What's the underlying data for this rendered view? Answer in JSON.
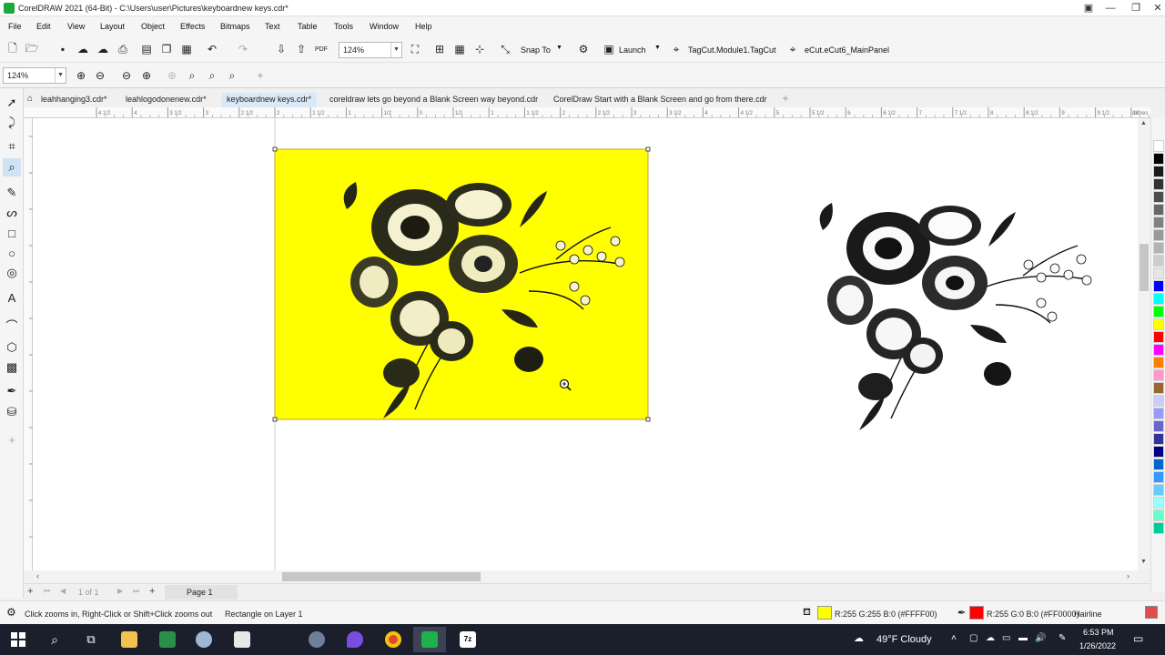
{
  "window": {
    "title": "CorelDRAW 2021 (64-Bit) - C:\\Users\\user\\Pictures\\keyboardnew keys.cdr*",
    "minimize": "—",
    "maximize": "❐",
    "close": "✕"
  },
  "menu": [
    "File",
    "Edit",
    "View",
    "Layout",
    "Object",
    "Effects",
    "Bitmaps",
    "Text",
    "Table",
    "Tools",
    "Window",
    "Help"
  ],
  "toolbar1": {
    "zoom_value": "124%",
    "snap_to": "Snap To",
    "launch": "Launch",
    "macro1": "TagCut.Module1.TagCut",
    "macro2": "eCut.eCut6_MainPanel"
  },
  "toolbar2": {
    "zoom_value": "124%"
  },
  "tabs": [
    {
      "label": "leahhanging3.cdr*",
      "active": false
    },
    {
      "label": "leahlogodonenew.cdr*",
      "active": false
    },
    {
      "label": "keyboardnew keys.cdr*",
      "active": true
    },
    {
      "label": "coreldraw lets go beyond a Blank Screen way beyond.cdr",
      "active": false
    },
    {
      "label": "CorelDraw Start with a Blank Screen and go from there.cdr",
      "active": false
    }
  ],
  "ruler": {
    "unit": "inches",
    "labels": [
      "4 1/2",
      "4",
      "3 1/2",
      "3",
      "2 1/2",
      "2",
      "1 1/2",
      "1",
      "1/2",
      "0",
      "1/2",
      "1",
      "1 1/2",
      "2",
      "2 1/2",
      "3",
      "3 1/2",
      "4",
      "4 1/2",
      "5",
      "5 1/2",
      "6",
      "6 1/2",
      "7",
      "7 1/2",
      "8",
      "8 1/2",
      "9",
      "9 1/2",
      "10",
      "10 1/2",
      "11",
      "11 1/2"
    ]
  },
  "pager": {
    "page_count": "1 of 1",
    "page_tab": "Page 1"
  },
  "status": {
    "hint": "Click zooms in, Right-Click or Shift+Click zooms out",
    "selection": "Rectangle on Layer 1",
    "fill_label": "R:255 G:255 B:0 (#FFFF00)",
    "fill_color": "#FFFF00",
    "outline_label": "R:255 G:0 B:0 (#FF0000)",
    "outline_color": "#FF0000",
    "outline_width": "Hairline"
  },
  "palette": [
    "#ffffff",
    "#000000",
    "#1a1a1a",
    "#333333",
    "#4d4d4d",
    "#666666",
    "#808080",
    "#999999",
    "#b3b3b3",
    "#cccccc",
    "#e6e6e6",
    "#0000ff",
    "#00ffff",
    "#00ff00",
    "#ffff00",
    "#ff0000",
    "#ff00ff",
    "#ff8000",
    "#ff99cc",
    "#996633",
    "#ccccff",
    "#9999ff",
    "#6666cc",
    "#333399",
    "#000080",
    "#0066cc",
    "#3399ff",
    "#66ccff",
    "#99ffff",
    "#66ffcc",
    "#00cc99"
  ],
  "taskbar": {
    "weather": "49°F  Cloudy",
    "time": "6:53 PM",
    "date": "1/26/2022"
  }
}
